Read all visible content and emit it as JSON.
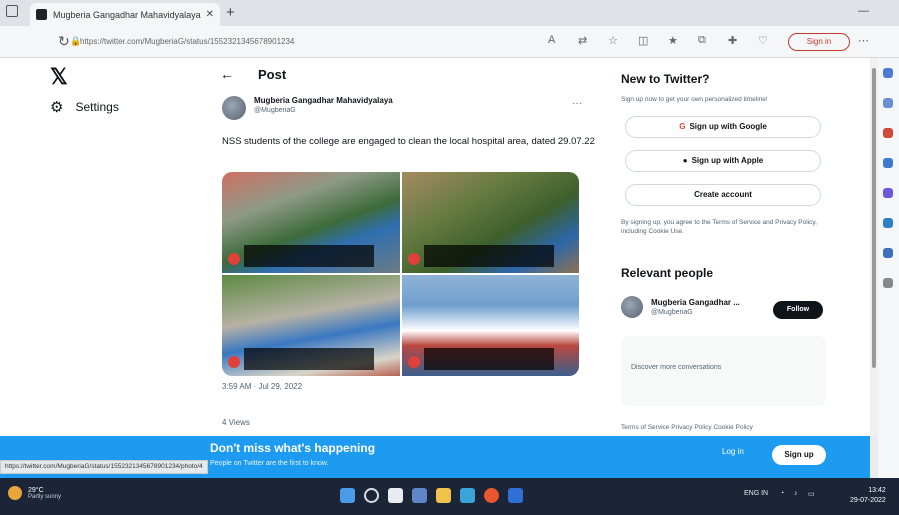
{
  "browser": {
    "tab_title": "Mugberia Gangadhar Mahavidyalaya",
    "tab_close": "✕",
    "newtab": "+",
    "url": "https://twitter.com/MugberiaG/status/1552321345678901234",
    "signin": "Sign in",
    "min": "—",
    "ellipsis": "⋯"
  },
  "sidebar": {
    "logo": "𝕏",
    "settings_label": "Settings"
  },
  "post": {
    "header": "Post",
    "author_name": "Mugberia Gangadhar Mahavidyalaya",
    "author_handle": "@MugberiaG",
    "text": "NSS students of the college are engaged to clean the local hospital area, dated 29.07.22",
    "timestamp": "3:59 AM · Jul 29, 2022",
    "views": "4 Views"
  },
  "right": {
    "new_heading": "New to Twitter?",
    "new_sub": "Sign up now to get your own personalized timeline!",
    "google_btn": "Sign up with Google",
    "apple_btn": "Sign up with Apple",
    "create_btn": "Create account",
    "terms": "By signing up, you agree to the Terms of Service and Privacy Policy, including Cookie Use.",
    "relevant_heading": "Relevant people",
    "person_name": "Mugberia Gangadhar ...",
    "person_handle": "@MugberiaG",
    "follow": "Follow",
    "discover": "Discover more conversations",
    "footer": "Terms of Service   Privacy Policy   Cookie Policy"
  },
  "banner": {
    "title": "Don't miss what's happening",
    "subtitle": "People on Twitter are the first to know.",
    "login": "Log in",
    "signup": "Sign up"
  },
  "status_url": "https://twitter.com/MugberiaG/status/1552321345678901234/photo/4",
  "taskbar": {
    "weather_temp": "29°C",
    "weather_desc": "Partly sunny",
    "lang": "ENG IN",
    "time": "13:42",
    "date": "29-07-2022"
  }
}
